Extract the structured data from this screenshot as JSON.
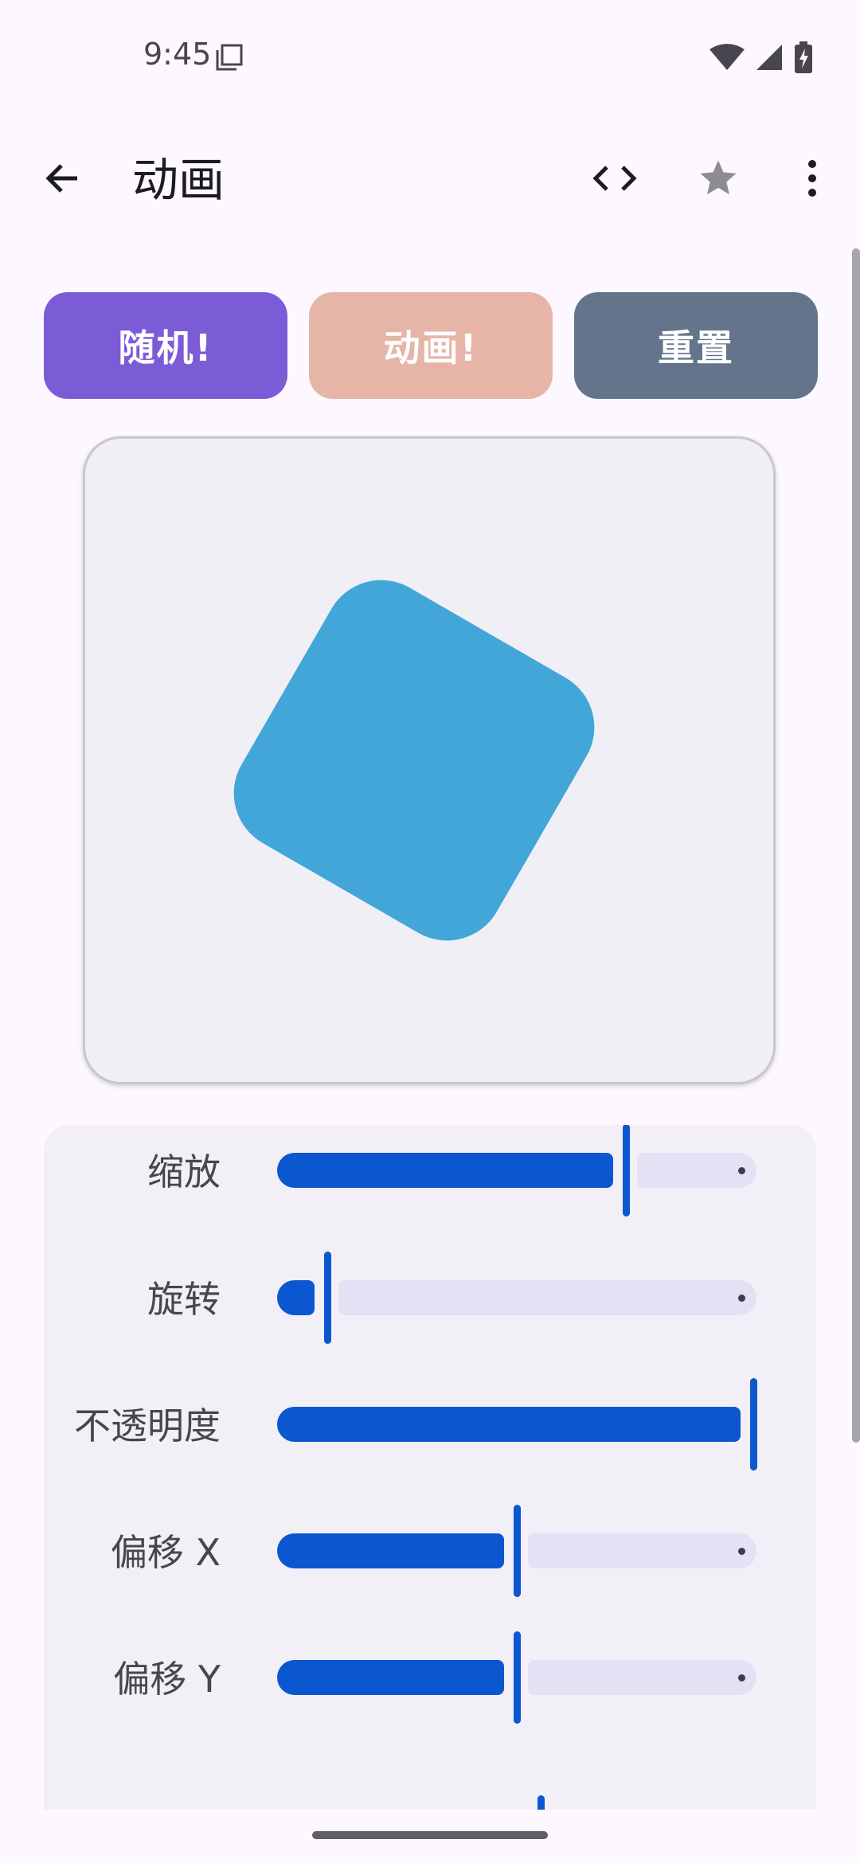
{
  "status_bar": {
    "time": "9:45"
  },
  "app_bar": {
    "title": "动画"
  },
  "actions": {
    "random": "随机!",
    "animate": "动画!",
    "reset": "重置"
  },
  "colors": {
    "random_button": "#7b5cd6",
    "animate_button": "#e7b4a8",
    "reset_button": "#64748b",
    "shape": "#42a7d8",
    "slider_active": "#0b57d0",
    "slider_inactive": "#e6e0f5"
  },
  "preview": {
    "shape_rotation_deg": 30
  },
  "sliders": [
    {
      "label": "缩放",
      "value": 0.73
    },
    {
      "label": "旋转",
      "value": 0.1
    },
    {
      "label": "不透明度",
      "value": 1.0
    },
    {
      "label": "偏移 X",
      "value": 0.5
    },
    {
      "label": "偏移 Y",
      "value": 0.5
    }
  ],
  "icons": {
    "back": "arrow-back-icon",
    "code": "code-icon",
    "star": "star-icon",
    "more": "more-vert-icon"
  }
}
